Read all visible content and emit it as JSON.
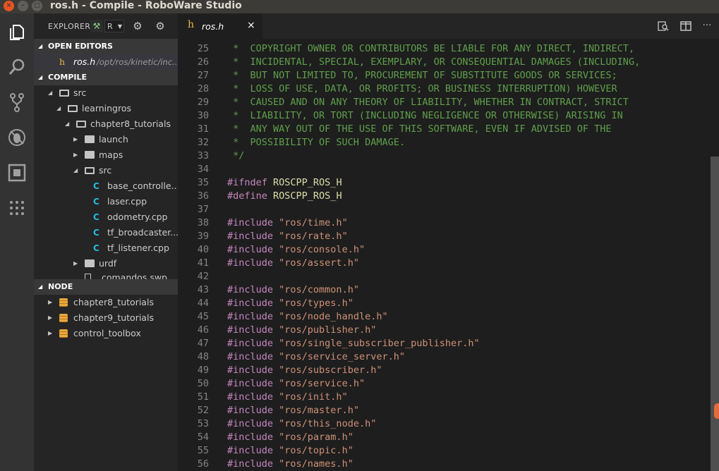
{
  "window": {
    "title": "ros.h - Compile - RoboWare Studio",
    "close_glyph": "×",
    "min_glyph": "–",
    "max_glyph": "□"
  },
  "activity_bar": {
    "icons": [
      "files-icon",
      "search-icon",
      "source-control-icon",
      "debug-icon",
      "extensions-icon",
      "apps-grid-icon"
    ]
  },
  "explorer": {
    "label": "EXPLORER",
    "project_select": "R",
    "open_editors": {
      "header": "OPEN EDITORS",
      "file": {
        "name": "ros.h",
        "path": "/opt/ros/kinetic/inc..."
      }
    },
    "compile": {
      "header": "COMPILE",
      "items": [
        {
          "label": "src"
        },
        {
          "label": "learningros"
        },
        {
          "label": "chapter8_tutorials"
        },
        {
          "label": "launch"
        },
        {
          "label": "maps"
        },
        {
          "label": "src"
        },
        {
          "label": "base_controlle..."
        },
        {
          "label": "laser.cpp"
        },
        {
          "label": "odometry.cpp"
        },
        {
          "label": "tf_broadcaster..."
        },
        {
          "label": "tf_listener.cpp"
        },
        {
          "label": "urdf"
        },
        {
          "label": ".comandos.swp"
        }
      ]
    },
    "node": {
      "header": "NODE",
      "items": [
        {
          "label": "chapter8_tutorials"
        },
        {
          "label": "chapter9_tutorials"
        },
        {
          "label": "control_toolbox"
        }
      ]
    }
  },
  "editor": {
    "tab": {
      "icon_glyph": "h",
      "name": "ros.h",
      "close_glyph": "×"
    },
    "lines": [
      {
        "n": "25",
        "text": " *  COPYRIGHT OWNER OR CONTRIBUTORS BE LIABLE FOR ANY DIRECT, INDIRECT,"
      },
      {
        "n": "26",
        "text": " *  INCIDENTAL, SPECIAL, EXEMPLARY, OR CONSEQUENTIAL DAMAGES (INCLUDING,"
      },
      {
        "n": "27",
        "text": " *  BUT NOT LIMITED TO, PROCUREMENT OF SUBSTITUTE GOODS OR SERVICES;"
      },
      {
        "n": "28",
        "text": " *  LOSS OF USE, DATA, OR PROFITS; OR BUSINESS INTERRUPTION) HOWEVER"
      },
      {
        "n": "29",
        "text": " *  CAUSED AND ON ANY THEORY OF LIABILITY, WHETHER IN CONTRACT, STRICT"
      },
      {
        "n": "30",
        "text": " *  LIABILITY, OR TORT (INCLUDING NEGLIGENCE OR OTHERWISE) ARISING IN"
      },
      {
        "n": "31",
        "text": " *  ANY WAY OUT OF THE USE OF THIS SOFTWARE, EVEN IF ADVISED OF THE"
      },
      {
        "n": "32",
        "text": " *  POSSIBILITY OF SUCH DAMAGE."
      },
      {
        "n": "33",
        "text": " */"
      },
      {
        "n": "34",
        "text": ""
      },
      {
        "n": "35",
        "kw": "#ifndef",
        "macro": " ROSCPP_ROS_H"
      },
      {
        "n": "36",
        "kw": "#define",
        "macro": " ROSCPP_ROS_H"
      },
      {
        "n": "37",
        "text": ""
      },
      {
        "n": "38",
        "kw": "#include",
        "str": " \"ros/time.h\""
      },
      {
        "n": "39",
        "kw": "#include",
        "str": " \"ros/rate.h\""
      },
      {
        "n": "40",
        "kw": "#include",
        "str": " \"ros/console.h\""
      },
      {
        "n": "41",
        "kw": "#include",
        "str": " \"ros/assert.h\""
      },
      {
        "n": "42",
        "text": ""
      },
      {
        "n": "43",
        "kw": "#include",
        "str": " \"ros/common.h\""
      },
      {
        "n": "44",
        "kw": "#include",
        "str": " \"ros/types.h\""
      },
      {
        "n": "45",
        "kw": "#include",
        "str": " \"ros/node_handle.h\""
      },
      {
        "n": "46",
        "kw": "#include",
        "str": " \"ros/publisher.h\""
      },
      {
        "n": "47",
        "kw": "#include",
        "str": " \"ros/single_subscriber_publisher.h\""
      },
      {
        "n": "48",
        "kw": "#include",
        "str": " \"ros/service_server.h\""
      },
      {
        "n": "49",
        "kw": "#include",
        "str": " \"ros/subscriber.h\""
      },
      {
        "n": "50",
        "kw": "#include",
        "str": " \"ros/service.h\""
      },
      {
        "n": "51",
        "kw": "#include",
        "str": " \"ros/init.h\""
      },
      {
        "n": "52",
        "kw": "#include",
        "str": " \"ros/master.h\""
      },
      {
        "n": "53",
        "kw": "#include",
        "str": " \"ros/this_node.h\""
      },
      {
        "n": "54",
        "kw": "#include",
        "str": " \"ros/param.h\""
      },
      {
        "n": "55",
        "kw": "#include",
        "str": " \"ros/topic.h\""
      },
      {
        "n": "56",
        "kw": "#include",
        "str": " \"ros/names.h\""
      }
    ]
  },
  "colors": {
    "comment": "#5f9f4b",
    "preprocessor": "#c586c0",
    "macro": "#dcdcaa",
    "string": "#ce9178",
    "accent": "#e95420"
  }
}
